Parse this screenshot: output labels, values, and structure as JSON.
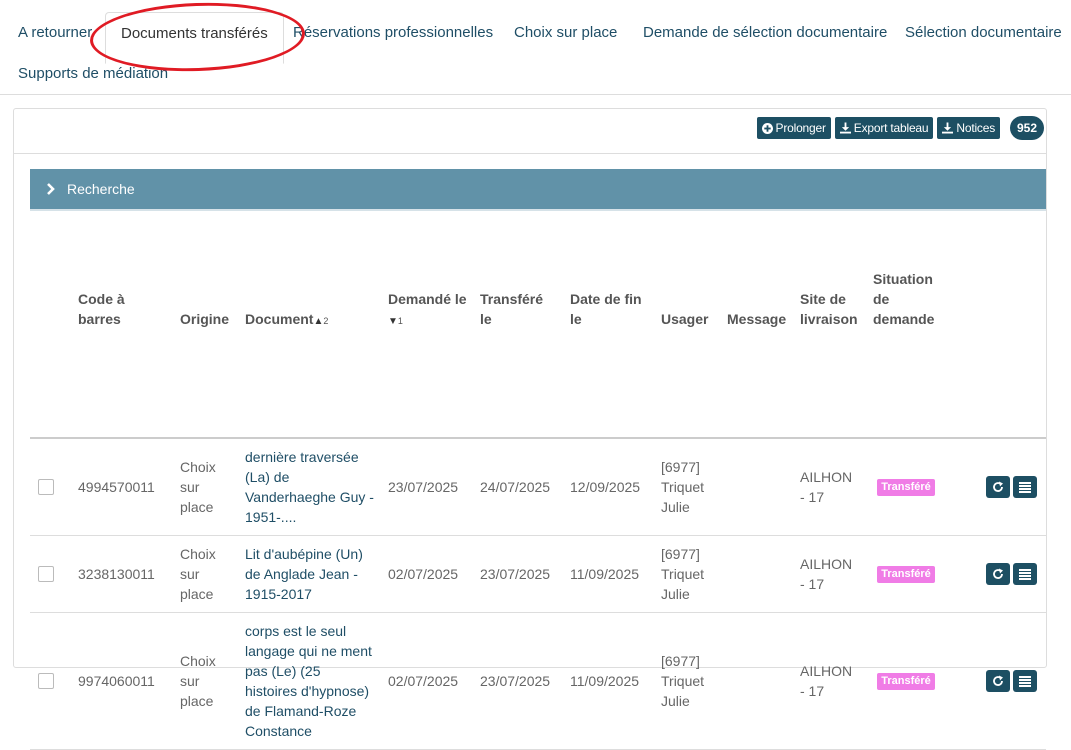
{
  "tabs": [
    {
      "label": "A retourner"
    },
    {
      "label": "Documents transférés"
    },
    {
      "label": "Réservations professionnelles"
    },
    {
      "label": "Choix sur place"
    },
    {
      "label": "Demande de sélection documentaire"
    },
    {
      "label": "Sélection documentaire"
    },
    {
      "label": "Supports de médiation"
    }
  ],
  "toolbar": {
    "prolonger_label": "Prolonger",
    "export_label": "Export tableau",
    "notices_label": "Notices",
    "count": "952"
  },
  "search": {
    "label": "Recherche"
  },
  "table": {
    "headers": {
      "barcode_1": "Code à",
      "barcode_2": "barres",
      "origin": "Origine",
      "document": "Document",
      "document_sort": "2",
      "requested_1": "Demandé le",
      "requested_sort": "1",
      "transferred_1": "Transféré",
      "transferred_2": "le",
      "enddate_1": "Date de fin",
      "enddate_2": "le",
      "user": "Usager",
      "message": "Message",
      "site_1": "Site de",
      "site_2": "livraison",
      "situation_1": "Situation",
      "situation_2": "de",
      "situation_3": "demande"
    },
    "rows": [
      {
        "barcode": "4994570011",
        "origin": [
          "Choix",
          "sur",
          "place"
        ],
        "document": [
          "dernière traversée",
          "(La) de",
          "Vanderhaeghe Guy -",
          "1951-...."
        ],
        "requested": "23/07/2025",
        "transferred": "24/07/2025",
        "enddate": "12/09/2025",
        "user": [
          "[6977]",
          "Triquet",
          "Julie"
        ],
        "site": [
          "AILHON",
          "- 17"
        ],
        "status": "Transféré"
      },
      {
        "barcode": "3238130011",
        "origin": [
          "Choix",
          "sur",
          "place"
        ],
        "document": [
          "Lit d'aubépine (Un)",
          "de Anglade Jean -",
          "1915-2017"
        ],
        "requested": "02/07/2025",
        "transferred": "23/07/2025",
        "enddate": "11/09/2025",
        "user": [
          "[6977]",
          "Triquet",
          "Julie"
        ],
        "site": [
          "AILHON",
          "- 17"
        ],
        "status": "Transféré"
      },
      {
        "barcode": "9974060011",
        "origin": [
          "Choix",
          "sur",
          "place"
        ],
        "document": [
          "corps est le seul",
          "langage qui ne ment",
          "pas (Le) (25",
          "histoires d'hypnose)",
          "de Flamand-Roze",
          "Constance"
        ],
        "requested": "02/07/2025",
        "transferred": "23/07/2025",
        "enddate": "11/09/2025",
        "user": [
          "[6977]",
          "Triquet",
          "Julie"
        ],
        "site": [
          "AILHON",
          "- 17"
        ],
        "status": "Transféré"
      }
    ]
  },
  "colors": {
    "primary": "#1d4f63",
    "search_bar": "#6192a8",
    "status_badge": "#f07ce6",
    "link": "#1f4e66",
    "annotation_oval": "#e01b24"
  }
}
